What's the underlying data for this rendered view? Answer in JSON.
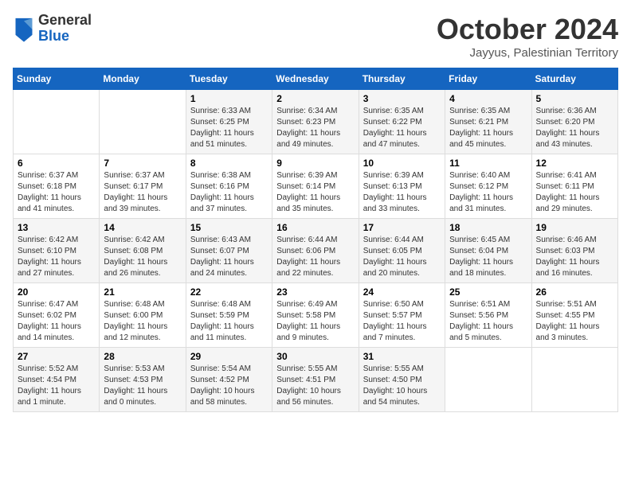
{
  "header": {
    "logo_general": "General",
    "logo_blue": "Blue",
    "month": "October 2024",
    "location": "Jayyus, Palestinian Territory"
  },
  "days_of_week": [
    "Sunday",
    "Monday",
    "Tuesday",
    "Wednesday",
    "Thursday",
    "Friday",
    "Saturday"
  ],
  "weeks": [
    [
      {
        "day": "",
        "content": ""
      },
      {
        "day": "",
        "content": ""
      },
      {
        "day": "1",
        "content": "Sunrise: 6:33 AM\nSunset: 6:25 PM\nDaylight: 11 hours and 51 minutes."
      },
      {
        "day": "2",
        "content": "Sunrise: 6:34 AM\nSunset: 6:23 PM\nDaylight: 11 hours and 49 minutes."
      },
      {
        "day": "3",
        "content": "Sunrise: 6:35 AM\nSunset: 6:22 PM\nDaylight: 11 hours and 47 minutes."
      },
      {
        "day": "4",
        "content": "Sunrise: 6:35 AM\nSunset: 6:21 PM\nDaylight: 11 hours and 45 minutes."
      },
      {
        "day": "5",
        "content": "Sunrise: 6:36 AM\nSunset: 6:20 PM\nDaylight: 11 hours and 43 minutes."
      }
    ],
    [
      {
        "day": "6",
        "content": "Sunrise: 6:37 AM\nSunset: 6:18 PM\nDaylight: 11 hours and 41 minutes."
      },
      {
        "day": "7",
        "content": "Sunrise: 6:37 AM\nSunset: 6:17 PM\nDaylight: 11 hours and 39 minutes."
      },
      {
        "day": "8",
        "content": "Sunrise: 6:38 AM\nSunset: 6:16 PM\nDaylight: 11 hours and 37 minutes."
      },
      {
        "day": "9",
        "content": "Sunrise: 6:39 AM\nSunset: 6:14 PM\nDaylight: 11 hours and 35 minutes."
      },
      {
        "day": "10",
        "content": "Sunrise: 6:39 AM\nSunset: 6:13 PM\nDaylight: 11 hours and 33 minutes."
      },
      {
        "day": "11",
        "content": "Sunrise: 6:40 AM\nSunset: 6:12 PM\nDaylight: 11 hours and 31 minutes."
      },
      {
        "day": "12",
        "content": "Sunrise: 6:41 AM\nSunset: 6:11 PM\nDaylight: 11 hours and 29 minutes."
      }
    ],
    [
      {
        "day": "13",
        "content": "Sunrise: 6:42 AM\nSunset: 6:10 PM\nDaylight: 11 hours and 27 minutes."
      },
      {
        "day": "14",
        "content": "Sunrise: 6:42 AM\nSunset: 6:08 PM\nDaylight: 11 hours and 26 minutes."
      },
      {
        "day": "15",
        "content": "Sunrise: 6:43 AM\nSunset: 6:07 PM\nDaylight: 11 hours and 24 minutes."
      },
      {
        "day": "16",
        "content": "Sunrise: 6:44 AM\nSunset: 6:06 PM\nDaylight: 11 hours and 22 minutes."
      },
      {
        "day": "17",
        "content": "Sunrise: 6:44 AM\nSunset: 6:05 PM\nDaylight: 11 hours and 20 minutes."
      },
      {
        "day": "18",
        "content": "Sunrise: 6:45 AM\nSunset: 6:04 PM\nDaylight: 11 hours and 18 minutes."
      },
      {
        "day": "19",
        "content": "Sunrise: 6:46 AM\nSunset: 6:03 PM\nDaylight: 11 hours and 16 minutes."
      }
    ],
    [
      {
        "day": "20",
        "content": "Sunrise: 6:47 AM\nSunset: 6:02 PM\nDaylight: 11 hours and 14 minutes."
      },
      {
        "day": "21",
        "content": "Sunrise: 6:48 AM\nSunset: 6:00 PM\nDaylight: 11 hours and 12 minutes."
      },
      {
        "day": "22",
        "content": "Sunrise: 6:48 AM\nSunset: 5:59 PM\nDaylight: 11 hours and 11 minutes."
      },
      {
        "day": "23",
        "content": "Sunrise: 6:49 AM\nSunset: 5:58 PM\nDaylight: 11 hours and 9 minutes."
      },
      {
        "day": "24",
        "content": "Sunrise: 6:50 AM\nSunset: 5:57 PM\nDaylight: 11 hours and 7 minutes."
      },
      {
        "day": "25",
        "content": "Sunrise: 6:51 AM\nSunset: 5:56 PM\nDaylight: 11 hours and 5 minutes."
      },
      {
        "day": "26",
        "content": "Sunrise: 5:51 AM\nSunset: 4:55 PM\nDaylight: 11 hours and 3 minutes."
      }
    ],
    [
      {
        "day": "27",
        "content": "Sunrise: 5:52 AM\nSunset: 4:54 PM\nDaylight: 11 hours and 1 minute."
      },
      {
        "day": "28",
        "content": "Sunrise: 5:53 AM\nSunset: 4:53 PM\nDaylight: 11 hours and 0 minutes."
      },
      {
        "day": "29",
        "content": "Sunrise: 5:54 AM\nSunset: 4:52 PM\nDaylight: 10 hours and 58 minutes."
      },
      {
        "day": "30",
        "content": "Sunrise: 5:55 AM\nSunset: 4:51 PM\nDaylight: 10 hours and 56 minutes."
      },
      {
        "day": "31",
        "content": "Sunrise: 5:55 AM\nSunset: 4:50 PM\nDaylight: 10 hours and 54 minutes."
      },
      {
        "day": "",
        "content": ""
      },
      {
        "day": "",
        "content": ""
      }
    ]
  ]
}
